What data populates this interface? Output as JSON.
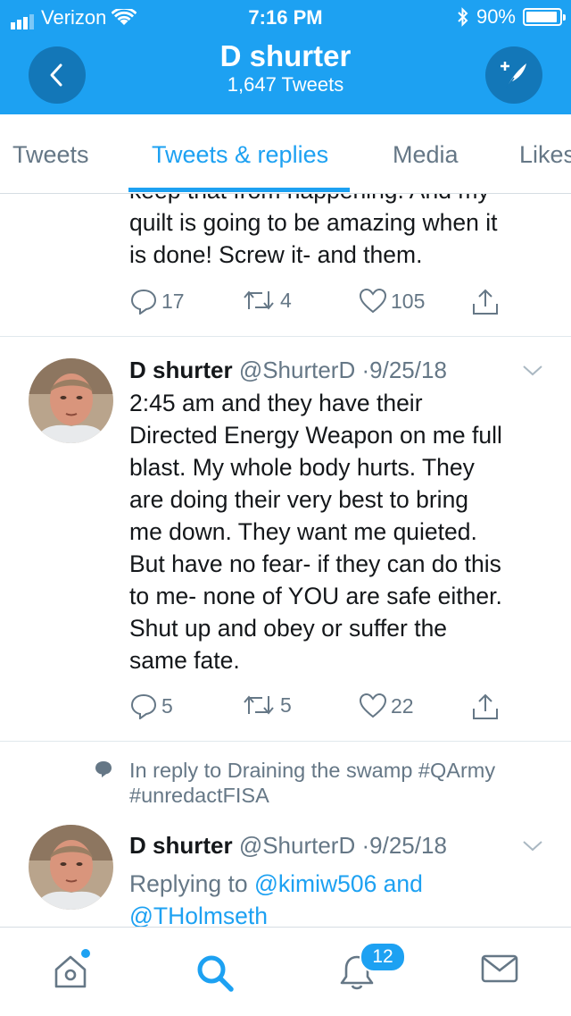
{
  "status_bar": {
    "carrier": "Verizon",
    "time": "7:16 PM",
    "battery": "90%"
  },
  "header": {
    "title": "D shurter",
    "subtitle": "1,647 Tweets"
  },
  "tabs": [
    {
      "label": "Tweets"
    },
    {
      "label": "Tweets & replies"
    },
    {
      "label": "Media"
    },
    {
      "label": "Likes"
    }
  ],
  "tweets": [
    {
      "lines": [
        "keep that from happening. And my",
        "quilt is going to be amazing when it",
        "is done! Screw it- and them."
      ],
      "replies": "17",
      "retweets": "4",
      "likes": "105"
    },
    {
      "name": "D shurter",
      "handle": "@ShurterD",
      "date": "9/25/18",
      "lines": [
        "2:45 am and they have their",
        "Directed Energy Weapon on me full",
        "blast. My whole body hurts. They",
        "are doing their very best to bring",
        "me down. They want me quieted.",
        "But have no fear- if they can do this",
        "to me- none of YOU are safe either.",
        "Shut up and obey or suffer the",
        "same fate."
      ],
      "replies": "5",
      "retweets": "5",
      "likes": "22"
    },
    {
      "context_lines": [
        "In reply to Draining the swamp #QArmy",
        "#unredactFISA"
      ],
      "name": "D shurter",
      "handle": "@ShurterD",
      "date": "9/25/18",
      "replying_prefix": "Replying to ",
      "replying_user1": "@kimiw506",
      "replying_and": " and",
      "replying_user2": "@THolmseth"
    }
  ],
  "bottom_nav": {
    "notification_count": "12"
  },
  "colors": {
    "accent": "#1da1f2",
    "text": "#14171a",
    "secondary": "#657786"
  }
}
